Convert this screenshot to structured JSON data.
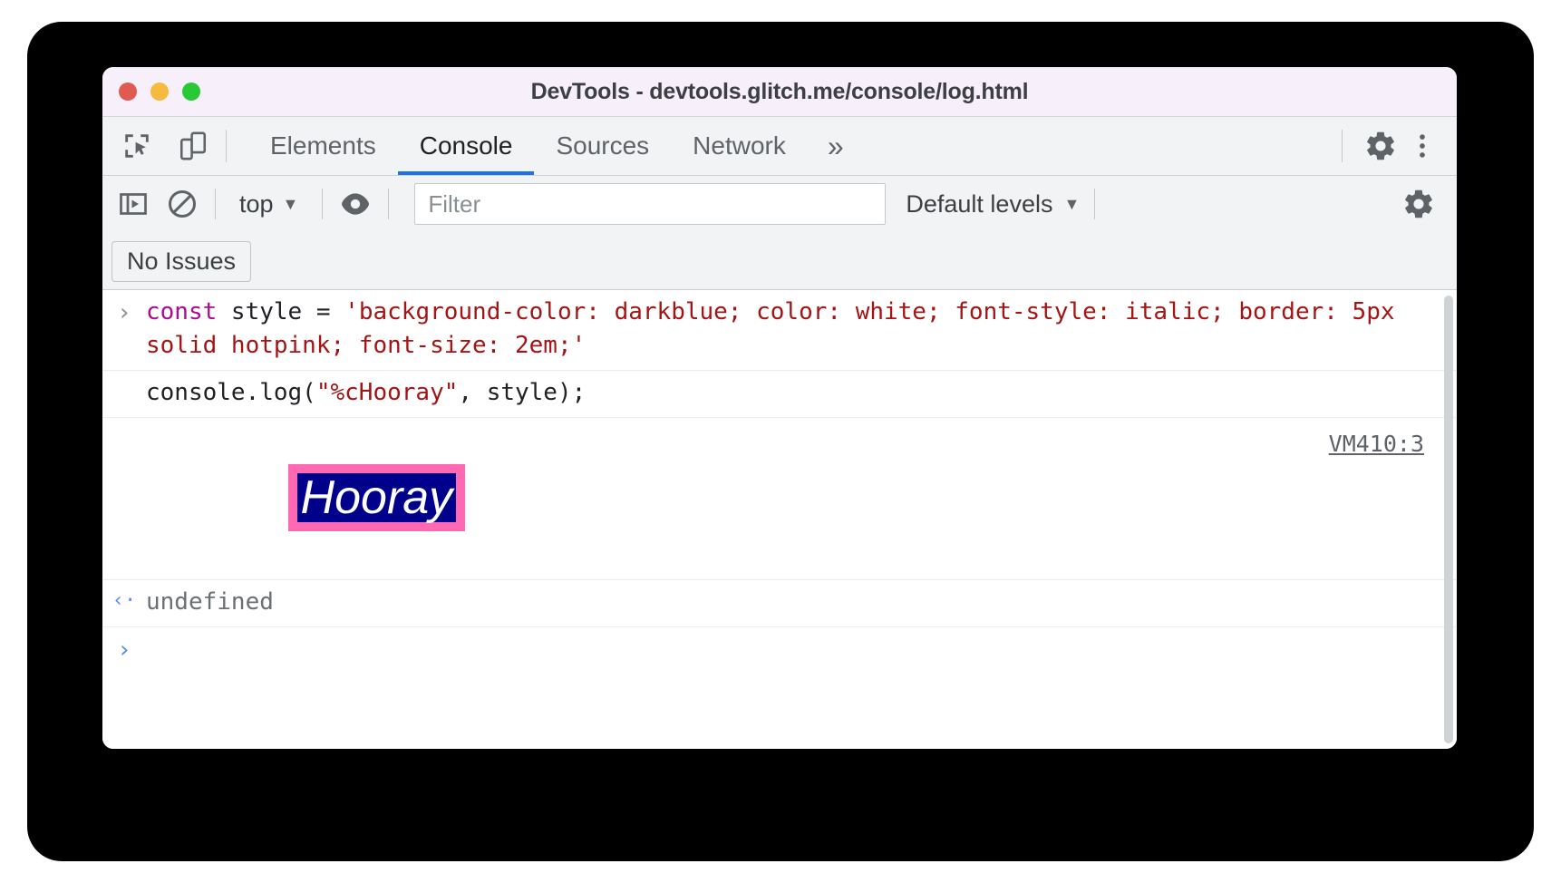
{
  "window": {
    "title": "DevTools - devtools.glitch.me/console/log.html",
    "traffic_lights": [
      "close-red",
      "minimize-yellow",
      "maximize-green"
    ],
    "colors": {
      "titlebar_bg": "#f7effa",
      "toolbar_bg": "#f1f3f4",
      "accent_blue": "#1a73e8"
    }
  },
  "toolbar": {
    "inspect_icon": "inspect-element-icon",
    "device_icon": "device-toolbar-icon",
    "tabs": [
      {
        "label": "Elements",
        "active": false
      },
      {
        "label": "Console",
        "active": true
      },
      {
        "label": "Sources",
        "active": false
      },
      {
        "label": "Network",
        "active": false
      }
    ],
    "more_tabs": "»",
    "settings_icon": "gear-icon",
    "more_options_icon": "kebab-menu-icon"
  },
  "console_toolbar": {
    "sidebar_toggle_icon": "console-sidebar-icon",
    "clear_icon": "clear-console-icon",
    "context": {
      "label": "top",
      "caret": "▼"
    },
    "eye_icon": "live-expression-eye-icon",
    "filter": {
      "value": "",
      "placeholder": "Filter"
    },
    "levels": {
      "label": "Default levels",
      "caret": "▼"
    },
    "console_settings_icon": "gear-icon"
  },
  "issues_bar": {
    "button_label": "No Issues"
  },
  "console": {
    "messages": [
      {
        "type": "input",
        "gutter": "›",
        "lines": [
          [
            {
              "text": "const",
              "style": "kw"
            },
            {
              "text": " style = ",
              "style": "plain"
            },
            {
              "text": "'background-color: darkblue; color: white; font-style: italic; border: 5px solid hotpink; font-size: 2em;'",
              "style": "str"
            }
          ]
        ]
      },
      {
        "type": "input",
        "gutter": "",
        "lines": [
          [
            {
              "text": "console.log(",
              "style": "plain"
            },
            {
              "text": "\"%cHooray\"",
              "style": "str"
            },
            {
              "text": ", style);",
              "style": "plain"
            }
          ]
        ]
      },
      {
        "type": "styled-output",
        "gutter": "",
        "text": "Hooray",
        "source": "VM410:3",
        "css": {
          "background-color": "darkblue",
          "color": "white",
          "font-style": "italic",
          "border": "5px solid hotpink",
          "font-size": "2em"
        }
      },
      {
        "type": "result",
        "gutter": "‹·",
        "text": "undefined"
      },
      {
        "type": "prompt",
        "gutter": "›",
        "text": ""
      }
    ]
  }
}
